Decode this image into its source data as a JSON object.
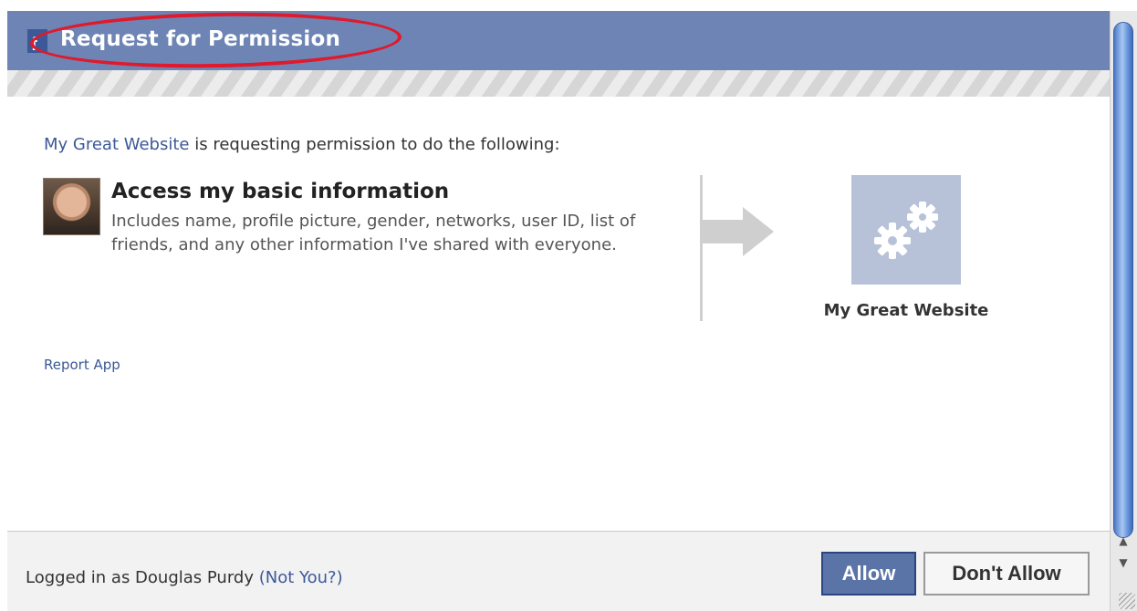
{
  "dialog": {
    "title": "Request for Permission",
    "logo_glyph": "f",
    "intro": {
      "site_name": "My Great Website",
      "rest": " is requesting permission to do the following:"
    },
    "permission": {
      "title": "Access my basic information",
      "description": "Includes name, profile picture, gender, networks, user ID, list of friends, and any other information I've shared with everyone."
    },
    "app": {
      "name": "My Great Website",
      "icon": "gears-icon"
    },
    "report_link": "Report App"
  },
  "footer": {
    "logged_in_prefix": "Logged in as Douglas Purdy ",
    "not_you": "(Not You?)",
    "allow_label": "Allow",
    "dont_allow_label": "Don't Allow"
  },
  "scrollbar": {
    "up_glyph": "▲",
    "down_glyph": "▼"
  },
  "colors": {
    "title_bar": "#6d84b4",
    "link": "#3b5998",
    "annotation_circle": "#e0192b",
    "allow_button": "#5b74a8"
  }
}
